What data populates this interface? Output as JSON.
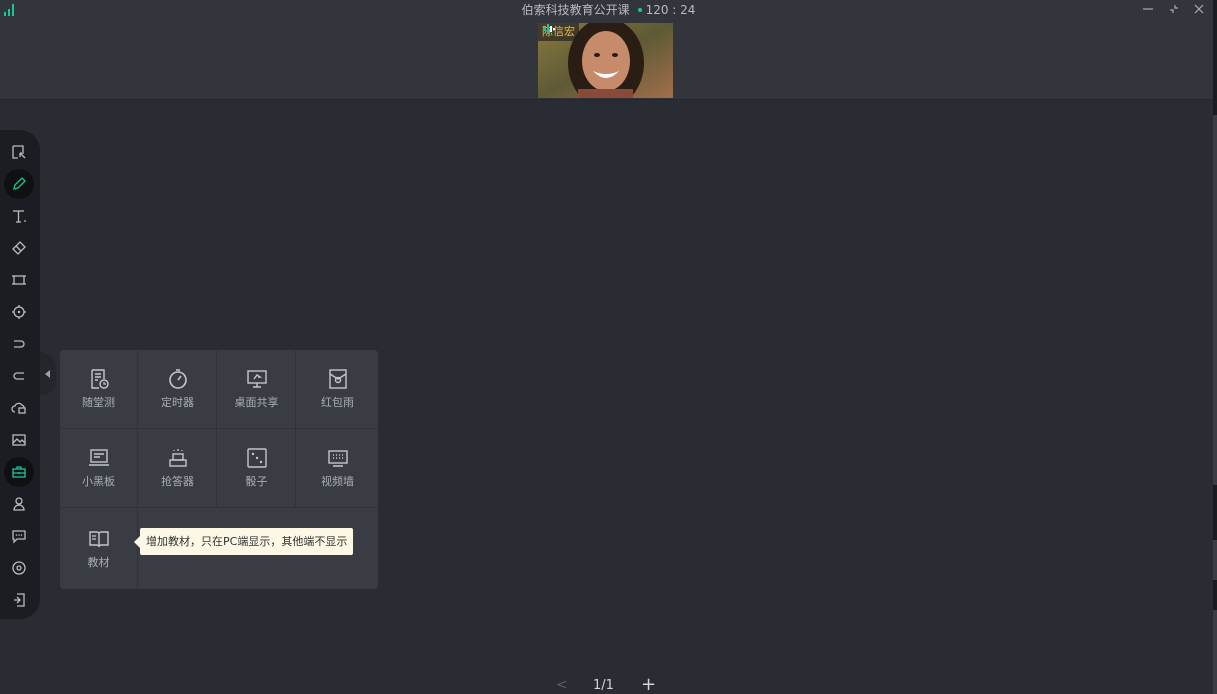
{
  "header": {
    "title": "伯索科技教育公开课",
    "timer": "120 : 24",
    "live_dot_color": "#19c59b",
    "window_controls": [
      "minimize-icon",
      "shrink-icon",
      "close-icon"
    ]
  },
  "video": {
    "participant_name": "陈信宏",
    "mic_icon": "mic-active-icon"
  },
  "toolbar": {
    "items": [
      {
        "name": "select-icon"
      },
      {
        "name": "pen-icon",
        "active": true
      },
      {
        "name": "text-icon"
      },
      {
        "name": "eraser-icon"
      },
      {
        "name": "shape-icon"
      },
      {
        "name": "laser-pointer-icon"
      },
      {
        "name": "undo-icon"
      },
      {
        "name": "redo-icon"
      },
      {
        "name": "cloud-drive-icon"
      },
      {
        "name": "image-icon"
      },
      {
        "name": "toolbox-icon",
        "active": true
      },
      {
        "name": "user-icon"
      },
      {
        "name": "chat-icon"
      },
      {
        "name": "settings-icon"
      },
      {
        "name": "exit-icon"
      }
    ],
    "active_color": "#19c59b"
  },
  "tools_panel": {
    "items": [
      {
        "label": "随堂测",
        "icon": "quiz-icon"
      },
      {
        "label": "定时器",
        "icon": "timer-icon"
      },
      {
        "label": "桌面共享",
        "icon": "screen-share-icon"
      },
      {
        "label": "红包雨",
        "icon": "red-packet-icon"
      },
      {
        "label": "小黑板",
        "icon": "blackboard-icon"
      },
      {
        "label": "抢答器",
        "icon": "buzzer-icon"
      },
      {
        "label": "骰子",
        "icon": "dice-icon"
      },
      {
        "label": "视频墙",
        "icon": "video-wall-icon"
      },
      {
        "label": "教材",
        "icon": "textbook-icon"
      }
    ]
  },
  "tooltip": {
    "text": "增加教材，只在PC端显示，其他端不显示"
  },
  "pager": {
    "page": "1/1",
    "prev_symbol": "<",
    "add_symbol": "+"
  }
}
